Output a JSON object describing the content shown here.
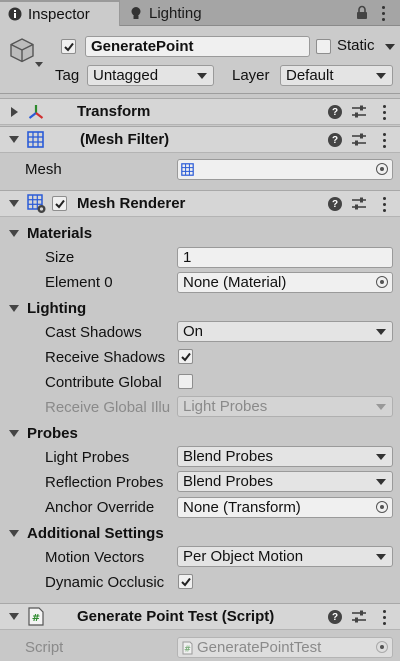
{
  "tabs": {
    "inspector": "Inspector",
    "lighting": "Lighting"
  },
  "header": {
    "object_name": "GeneratePoint",
    "static_label": "Static",
    "tag_label": "Tag",
    "tag_value": "Untagged",
    "layer_label": "Layer",
    "layer_value": "Default"
  },
  "transform": {
    "title": "Transform"
  },
  "mesh_filter": {
    "title": "(Mesh Filter)",
    "mesh_label": "Mesh",
    "mesh_value": ""
  },
  "mesh_renderer": {
    "title": "Mesh Renderer",
    "materials": {
      "section": "Materials",
      "size_label": "Size",
      "size_value": "1",
      "element0_label": "Element 0",
      "element0_value": "None (Material)"
    },
    "lighting": {
      "section": "Lighting",
      "cast_shadows_label": "Cast Shadows",
      "cast_shadows_value": "On",
      "receive_shadows_label": "Receive Shadows",
      "receive_shadows_checked": true,
      "contribute_global_label": "Contribute Global",
      "contribute_global_checked": false,
      "receive_global_label": "Receive Global Illu",
      "receive_global_value": "Light Probes"
    },
    "probes": {
      "section": "Probes",
      "light_probes_label": "Light Probes",
      "light_probes_value": "Blend Probes",
      "reflection_probes_label": "Reflection Probes",
      "reflection_probes_value": "Blend Probes",
      "anchor_override_label": "Anchor Override",
      "anchor_override_value": "None (Transform)"
    },
    "additional": {
      "section": "Additional Settings",
      "motion_vectors_label": "Motion Vectors",
      "motion_vectors_value": "Per Object Motion",
      "dynamic_occlusion_label": "Dynamic Occlusic",
      "dynamic_occlusion_checked": true
    }
  },
  "script_component": {
    "title": "Generate Point Test (Script)",
    "script_label": "Script",
    "script_value": "GeneratePointTest"
  },
  "colors": {
    "panel_bg": "#c8c8c8",
    "tab_bar_bg": "#a5a5a5",
    "component_header_bg": "#d6d6d6",
    "field_bg": "#f0f0f0"
  }
}
